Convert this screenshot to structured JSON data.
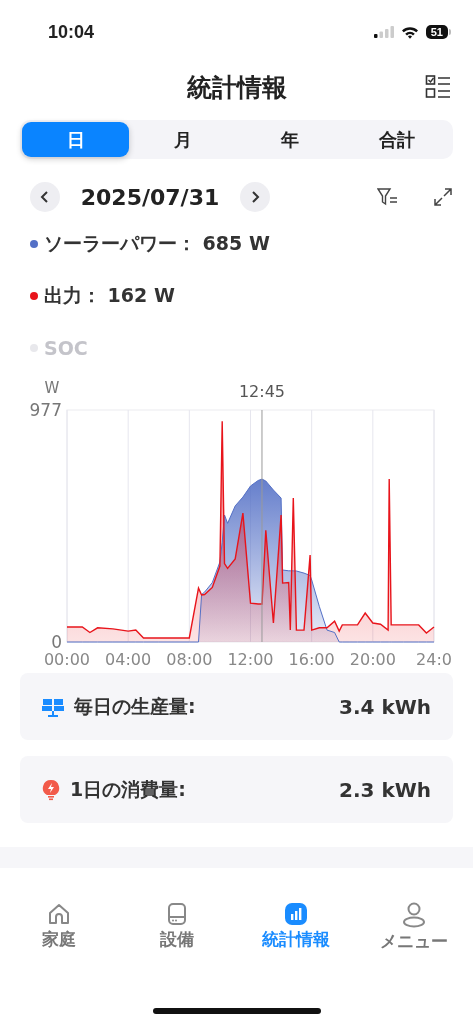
{
  "status_bar": {
    "time": "10:04",
    "battery": "51"
  },
  "header": {
    "title": "統計情報"
  },
  "period_tabs": [
    {
      "label": "日",
      "selected": true
    },
    {
      "label": "月",
      "selected": false
    },
    {
      "label": "年",
      "selected": false
    },
    {
      "label": "合計",
      "selected": false
    }
  ],
  "date_nav": {
    "date": "2025/07/31"
  },
  "legend": [
    {
      "kind": "series",
      "separator": "：",
      "value": "685 W",
      "active": true
    },
    {
      "kind": "series",
      "separator": "：",
      "value": "162 W",
      "active": true
    },
    {
      "label": "SOC",
      "color": "#e8e8ec",
      "active": false
    }
  ],
  "chart": {
    "chart_data": {
      "type": "area",
      "ylabel": "W",
      "x": [
        0,
        1,
        1.5,
        2,
        3,
        4,
        4.5,
        5,
        6,
        7,
        8,
        8.6,
        8.8,
        9,
        9.5,
        10,
        10.15,
        10.3,
        10.5,
        11,
        11.5,
        12,
        12.5,
        12.75,
        13,
        13.5,
        14,
        14.1,
        14.5,
        14.6,
        14.8,
        15,
        15.5,
        15.9,
        16,
        16.5,
        17,
        17.5,
        17.8,
        18,
        18.5,
        19,
        19.5,
        20,
        20.5,
        21,
        21.07,
        21.2,
        22,
        23,
        23.5,
        24
      ],
      "series": [
        {
          "name": "ソーラーパワー",
          "color": "#5470c6",
          "values": [
            0,
            0,
            0,
            0,
            0,
            0,
            0,
            0,
            0,
            0,
            0,
            0,
            200,
            210,
            250,
            337,
            420,
            535,
            500,
            573,
            610,
            657,
            680,
            686,
            678,
            640,
            606,
            303,
            300,
            300,
            300,
            299,
            290,
            280,
            261,
            150,
            50,
            40,
            0,
            0,
            0,
            0,
            0,
            0,
            0,
            0,
            0,
            0,
            0,
            0,
            0,
            0
          ]
        },
        {
          "name": "出力",
          "color": "#e8141b",
          "values": [
            63,
            63,
            40,
            60,
            55,
            46,
            50,
            17,
            17,
            17,
            17,
            227,
            198,
            200,
            230,
            320,
            930,
            330,
            310,
            350,
            543,
            164,
            160,
            160,
            470,
            80,
            535,
            248,
            250,
            50,
            606,
            50,
            50,
            366,
            50,
            60,
            60,
            88,
            46,
            72,
            72,
            72,
            122,
            80,
            75,
            50,
            686,
            72,
            72,
            72,
            38,
            63
          ]
        }
      ],
      "xlim": [
        0,
        24
      ],
      "ylim": [
        0,
        977
      ],
      "xticks": [
        {
          "value": 0,
          "label": "00:00"
        },
        {
          "value": 4,
          "label": "04:00"
        },
        {
          "value": 8,
          "label": "08:00"
        },
        {
          "value": 12,
          "label": "12:00"
        },
        {
          "value": 16,
          "label": "16:00"
        },
        {
          "value": 20,
          "label": "20:00"
        },
        {
          "value": 24,
          "label": "24:0"
        }
      ],
      "yticks": [
        0,
        977
      ],
      "grid": true,
      "ref_lines": [
        {
          "axis": "x",
          "value": 12.75
        }
      ]
    },
    "crosshair_time": "12:45"
  },
  "summary": [
    {
      "kind": "production",
      "label": "毎日の生産量:",
      "value": "3.4 kWh"
    },
    {
      "kind": "consumption",
      "label": "1日の消費量:",
      "value": "2.3 kWh"
    }
  ],
  "tab_bar": [
    {
      "kind": "home",
      "label": "家庭",
      "selected": false
    },
    {
      "kind": "device",
      "label": "設備",
      "selected": false
    },
    {
      "kind": "stats",
      "label": "統計情報",
      "selected": true
    },
    {
      "kind": "menu",
      "label": "メニュー",
      "selected": false
    }
  ]
}
